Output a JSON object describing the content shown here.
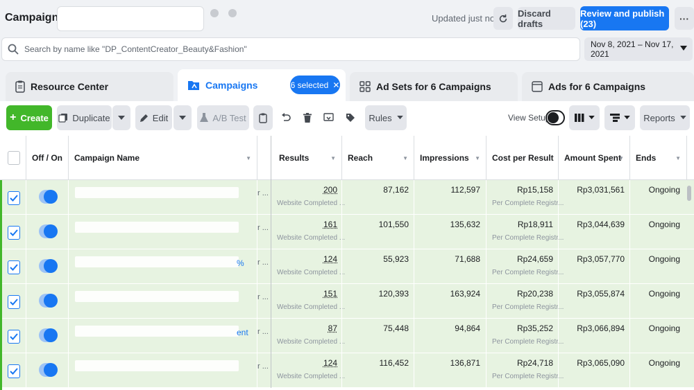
{
  "header": {
    "title": "Campaigns",
    "updated": "Updated just now",
    "discard_label": "Discard drafts",
    "publish_label": "Review and publish (23)"
  },
  "search": {
    "placeholder": "Search by name like \"DP_ContentCreator_Beauty&Fashion\"",
    "date_range": "Nov 8, 2021 – Nov 17, 2021"
  },
  "tabs": {
    "resource": "Resource Center",
    "campaigns": "Campaigns",
    "selected_chip": "6 selected",
    "adsets": "Ad Sets for 6 Campaigns",
    "ads": "Ads for 6 Campaigns"
  },
  "toolbar": {
    "create": "Create",
    "duplicate": "Duplicate",
    "edit": "Edit",
    "ab_test": "A/B Test",
    "rules": "Rules",
    "view_setup": "View Setup",
    "reports": "Reports"
  },
  "table": {
    "columns": {
      "off_on": "Off / On",
      "campaign_name": "Campaign Name",
      "results": "Results",
      "reach": "Reach",
      "impressions": "Impressions",
      "cost_per_result": "Cost per Result",
      "amount_spent": "Amount Spent",
      "ends": "Ends"
    },
    "rows": [
      {
        "name_suffix": "",
        "results": "200",
        "results_sub": "Website Completed ...",
        "reach": "87,162",
        "impressions": "112,597",
        "cpr": "Rp15,158",
        "cpr_sub": "Per Complete Registr...",
        "spent": "Rp3,031,561",
        "ends": "Ongoing"
      },
      {
        "name_suffix": "",
        "results": "161",
        "results_sub": "Website Completed ...",
        "reach": "101,550",
        "impressions": "135,632",
        "cpr": "Rp18,911",
        "cpr_sub": "Per Complete Registr...",
        "spent": "Rp3,044,639",
        "ends": "Ongoing"
      },
      {
        "name_suffix": "%",
        "results": "124",
        "results_sub": "Website Completed ...",
        "reach": "55,923",
        "impressions": "71,688",
        "cpr": "Rp24,659",
        "cpr_sub": "Per Complete Registr...",
        "spent": "Rp3,057,770",
        "ends": "Ongoing"
      },
      {
        "name_suffix": "",
        "results": "151",
        "results_sub": "Website Completed ...",
        "reach": "120,393",
        "impressions": "163,924",
        "cpr": "Rp20,238",
        "cpr_sub": "Per Complete Registr...",
        "spent": "Rp3,055,874",
        "ends": "Ongoing"
      },
      {
        "name_suffix": "ent",
        "results": "87",
        "results_sub": "Website Completed ...",
        "reach": "75,448",
        "impressions": "94,864",
        "cpr": "Rp35,252",
        "cpr_sub": "Per Complete Registr...",
        "spent": "Rp3,066,894",
        "ends": "Ongoing"
      },
      {
        "name_suffix": "",
        "results": "124",
        "results_sub": "Website Completed ...",
        "reach": "116,452",
        "impressions": "136,871",
        "cpr": "Rp24,718",
        "cpr_sub": "Per Complete Registr...",
        "spent": "Rp3,065,090",
        "ends": "Ongoing"
      }
    ]
  },
  "colors": {
    "primary": "#1877f2",
    "create_green": "#42b72a",
    "row_selected": "#e7f3e1"
  }
}
